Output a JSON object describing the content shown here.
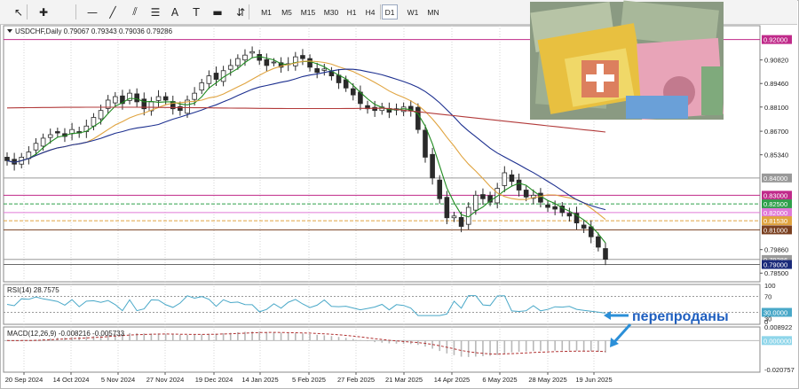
{
  "toolbar": {
    "timeframes": [
      "M1",
      "M5",
      "M15",
      "M30",
      "H1",
      "H4",
      "D1",
      "W1",
      "MN"
    ],
    "active_timeframe": "D1",
    "tools": [
      "cursor-icon",
      "crosshair-icon",
      "horizontal-line-icon",
      "trend-line-icon",
      "equidistant-channel-icon",
      "fibonacci-icon",
      "text-icon",
      "text-label-icon",
      "rectangle-icon",
      "arrows-icon"
    ]
  },
  "main_header": "USDCHF,Daily  0.79067 0.79343 0.79036 0.79286",
  "rsi_header": "RSI(14) 28.7575",
  "macd_header": "MACD(12,26,9) -0.008216 -0.005733",
  "annotation": "перепроданы",
  "colors": {
    "candle": "#2a2a2a",
    "ma_fast": "#1f8a1f",
    "ma_mid": "#e0a440",
    "ma_slow": "#1c2f8f",
    "ma_long": "#b23a3a",
    "rsi": "#49a8c8",
    "macd_signal": "#b03030",
    "arrow": "#2b8fd8",
    "annotation_text": "#1f5fbf"
  },
  "chart_data": [
    {
      "type": "candlestick",
      "symbol": "USDCHF",
      "timeframe": "Daily",
      "ohlc_last": {
        "open": 0.79067,
        "high": 0.79343,
        "low": 0.79036,
        "close": 0.79286
      },
      "ylim": [
        0.78,
        0.928
      ],
      "y_ticks": [
        "0.92000",
        "0.90820",
        "0.89460",
        "0.88100",
        "0.86700",
        "0.85340",
        "0.84000",
        "0.83000",
        "0.82500",
        "0.82000",
        "0.81530",
        "0.81000",
        "0.79860",
        "0.79286",
        "0.79000",
        "0.78500"
      ],
      "x_ticks": [
        "20 Sep 2024",
        "14 Oct 2024",
        "5 Nov 2024",
        "27 Nov 2024",
        "19 Dec 2024",
        "14 Jan 2025",
        "5 Feb 2025",
        "27 Feb 2025",
        "21 Mar 2025",
        "14 Apr 2025",
        "6 May 2025",
        "28 May 2025",
        "19 Jun 2025"
      ],
      "close_series": [
        0.85,
        0.848,
        0.852,
        0.855,
        0.86,
        0.863,
        0.865,
        0.866,
        0.864,
        0.868,
        0.866,
        0.87,
        0.875,
        0.879,
        0.885,
        0.887,
        0.883,
        0.889,
        0.884,
        0.88,
        0.884,
        0.887,
        0.885,
        0.88,
        0.879,
        0.885,
        0.889,
        0.895,
        0.899,
        0.897,
        0.902,
        0.905,
        0.909,
        0.911,
        0.913,
        0.908,
        0.905,
        0.907,
        0.904,
        0.906,
        0.91,
        0.909,
        0.904,
        0.901,
        0.903,
        0.899,
        0.895,
        0.892,
        0.888,
        0.883,
        0.88,
        0.879,
        0.881,
        0.878,
        0.88,
        0.881,
        0.879,
        0.868,
        0.852,
        0.84,
        0.828,
        0.817,
        0.818,
        0.812,
        0.823,
        0.83,
        0.828,
        0.826,
        0.834,
        0.843,
        0.838,
        0.833,
        0.829,
        0.83,
        0.826,
        0.823,
        0.822,
        0.82,
        0.818,
        0.814,
        0.811,
        0.806,
        0.8,
        0.793
      ],
      "horizontal_levels": [
        {
          "value": 0.92,
          "color": "#c02a8a",
          "label": "0.92000"
        },
        {
          "value": 0.84,
          "color": "#999999",
          "label": "0.84000"
        },
        {
          "value": 0.83,
          "color": "#c02a8a",
          "label": "0.83000"
        },
        {
          "value": 0.825,
          "color": "#2ea04a",
          "label": "0.82500",
          "dashed": true
        },
        {
          "value": 0.82,
          "color": "#e07ad8",
          "label": "0.82000"
        },
        {
          "value": 0.8153,
          "color": "#e0a440",
          "label": "0.81530",
          "dashed": true
        },
        {
          "value": 0.81,
          "color": "#7a4020",
          "label": "0.81000"
        },
        {
          "value": 0.7929,
          "color": "#9a9a9a",
          "label": "0.79286"
        },
        {
          "value": 0.79,
          "color": "#6a6a6a",
          "label": "0.79000"
        }
      ],
      "moving_averages": [
        {
          "name": "fast",
          "color": "#1f8a1f"
        },
        {
          "name": "mid",
          "color": "#e0a440"
        },
        {
          "name": "slow",
          "color": "#1c2f8f"
        },
        {
          "name": "long",
          "color": "#b23a3a"
        }
      ]
    },
    {
      "type": "line",
      "indicator": "RSI",
      "period": 14,
      "last_value": 28.7575,
      "ylim": [
        0,
        100
      ],
      "y_ticks": [
        "100",
        "70",
        "30.0000",
        "30",
        "0"
      ],
      "levels": [
        70,
        30
      ]
    },
    {
      "type": "bar",
      "indicator": "MACD",
      "params": [
        12,
        26,
        9
      ],
      "main": -0.008216,
      "signal": -0.005733,
      "y_ticks": [
        "0.008922",
        "0.000000",
        "-0.020757"
      ],
      "ylim": [
        -0.020757,
        0.008922
      ]
    }
  ]
}
